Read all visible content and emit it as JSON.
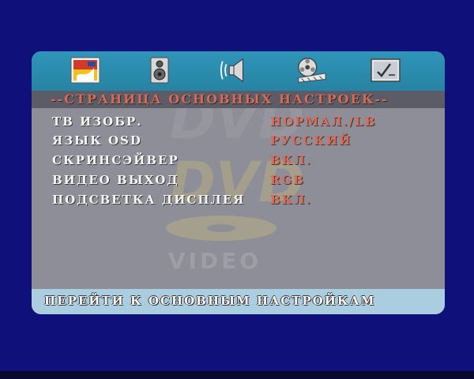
{
  "colors": {
    "screen_bg": "#10107a",
    "toolbar": "#2783a4",
    "panel": "#8e8e98",
    "title_bar": "#5c5c66",
    "title_text": "#d56a5a",
    "label_text": "#f4f4f4",
    "value_text": "#dd6b58",
    "footer": "#aacde0"
  },
  "toolbar": {
    "icons": [
      {
        "name": "general-setup-icon"
      },
      {
        "name": "speaker-setup-icon"
      },
      {
        "name": "audio-setup-icon"
      },
      {
        "name": "video-setup-icon"
      },
      {
        "name": "preferences-icon"
      }
    ]
  },
  "page": {
    "title": "--СТРАНИЦА ОСНОВНЫХ НАСТРОЕК--"
  },
  "settings": [
    {
      "label": "ТВ ИЗОБР.",
      "value": "НОРМАЛ./LB"
    },
    {
      "label": "ЯЗЫК OSD",
      "value": "РУССКИЙ"
    },
    {
      "label": "СКРИНСЭЙВЕР",
      "value": "ВКЛ."
    },
    {
      "label": "ВИДЕО ВЫХОД",
      "value": "RGB"
    },
    {
      "label": "ПОДСВЕТКА ДИСПЛЕЯ",
      "value": "ВКЛ."
    }
  ],
  "watermark": {
    "dvd_text": "DVD",
    "video_text": "VIDEO"
  },
  "footer": {
    "text": "ПЕРЕЙТИ К ОСНОВНЫМ НАСТРОЙКАМ"
  }
}
